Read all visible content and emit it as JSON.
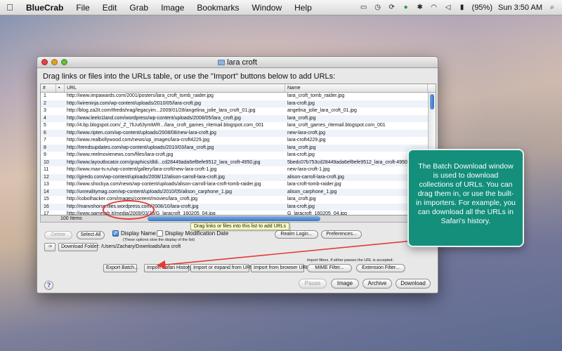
{
  "menubar": {
    "app_name": "BlueCrab",
    "items": [
      "File",
      "Edit",
      "Grab",
      "Image",
      "Bookmarks",
      "Window",
      "Help"
    ],
    "battery": "(95%)",
    "clock": "Sun 3:50 AM"
  },
  "window": {
    "title": "lara croft",
    "instructions": "Drag links or files into the URLs table, or use the \"Import\" buttons below to add URLs:",
    "table": {
      "headers": {
        "num": "#",
        "dot": "•",
        "url": "URL",
        "name": "Name"
      },
      "rows": [
        {
          "num": "1",
          "url": "http://www.impawards.com/2001/posters/lara_croft_tomb_raider.jpg",
          "name": "lara_croft_tomb_raider.jpg"
        },
        {
          "num": "2",
          "url": "http://wireninja.com/wp-content/uploads/2010/05/lara-croft.jpg",
          "name": "lara-croft.jpg"
        },
        {
          "num": "3",
          "url": "http://blog.za2it.com/thedishrag/legacyim...2009/01/28/angelina_jolie_lara_croft_01.jpg",
          "name": "angelina_jolie_lara_croft_01.jpg"
        },
        {
          "num": "4",
          "url": "http://www.leelo1land.com/wordpress/wp-content/uploads/2008/05/lara_croft.jpg",
          "name": "lara_croft.jpg"
        },
        {
          "num": "5",
          "url": "http://4.bp.blogspot.com/_Z_7lUu63ymM/R.../lara_croft_games_ritemail.blogspot.com_001",
          "name": "lara_croft_games_ritemail.blogspot.com_001"
        },
        {
          "num": "6",
          "url": "http://www.ripten.com/wp-content/uploads/2008/08/new-lara-croft.jpg",
          "name": "new-lara-croft.jpg"
        },
        {
          "num": "7",
          "url": "http://www.realbollywood.com/news/up_images/lara-croft4229.jpg",
          "name": "lara-croft4229.jpg"
        },
        {
          "num": "8",
          "url": "http://trendsupdates.com/wp-content/uploads/2010/03/lara_croft.jpg",
          "name": "lara_croft.jpg"
        },
        {
          "num": "9",
          "url": "http://www.reelmovienews.com/files/lara-croft.jpg",
          "name": "lara-croft.jpg"
        },
        {
          "num": "10",
          "url": "http://www.layoutlocator.com/graphics/dldi...cd28449ada6ef8efe9512_lara_croft-4950.jpg",
          "name": "5bedc07b753cd28449ada6ef8efe9512_lara_croft-4950"
        },
        {
          "num": "11",
          "url": "http://www.max-tv.ru/wp-content/gallery/lara-croft/new-lara-croft-1.jpg",
          "name": "new-lara-croft-1.jpg"
        },
        {
          "num": "12",
          "url": "http://giredo.com/wp-content/uploads/2008/12/alison-carroll-lara-croft.jpg",
          "name": "alison-carroll-lara-croft.jpg"
        },
        {
          "num": "13",
          "url": "http://www.shockya.com/news/wp-content/uploads/alison-carroll-lara-croft-tomb-raider.jpg",
          "name": "lara-croft-tomb-raider.jpg"
        },
        {
          "num": "14",
          "url": "http://unrealitymag.com/wp-content/uploads/2010/05/alison_carphone_1.jpg",
          "name": "alison_carphone_1.jpg"
        },
        {
          "num": "15",
          "url": "http://cobolhacker.com/images/content/movies/lara_croft.jpg",
          "name": "lara_croft.jpg"
        },
        {
          "num": "16",
          "url": "http://manvshorse.files.wordpress.com/2008/10/lara-croft.jpg",
          "name": "lara-croft.jpg"
        },
        {
          "num": "17",
          "url": "http://www.gametab.it/media/2009/03/28/G_laracroft_160205_04.jpg",
          "name": "G_laracroft_160205_04.jpg"
        }
      ],
      "items_count": "100 Items"
    },
    "tooltip": "Drag links or files into this list to add URLs",
    "buttons": {
      "delete": "Delete",
      "select_all": "Select All",
      "realm_login": "Realm Login...",
      "preferences": "Preferences...",
      "arrow": "->",
      "download_folder": "Download Folder:",
      "export_batch": "Export Batch...",
      "import_safari_history": "Import Safari History",
      "import_expand_url": "Import or expand from URL...",
      "import_browser_url": "Import from browser URL",
      "mime_filter": "MIME Filter...",
      "extension_filter": "Extension Filter...",
      "pause": "Pause",
      "image": "Image",
      "archive": "Archive",
      "download": "Download",
      "help": "?"
    },
    "checkboxes": {
      "display_name": {
        "label": "Display Name",
        "checked": true
      },
      "display_mod_date": {
        "label": "Display Modification Date",
        "checked": false
      }
    },
    "notes": {
      "slow_display": "(These options slow the display of the list)",
      "import_filters": "Import filters. If either passes the URL is accepted:"
    },
    "download_path": "/Users/Zachary/Downloads/lara croft"
  },
  "callout": {
    "text": "The Batch Download window is used to download collections of URLs. You can drag them in, or use the built-in importers. For example, you can download all the URLs in Safari's history."
  },
  "colors": {
    "callout_bg": "#148f7c",
    "highlight": "#e43a3a",
    "selection_blue": "#3c77c2"
  }
}
